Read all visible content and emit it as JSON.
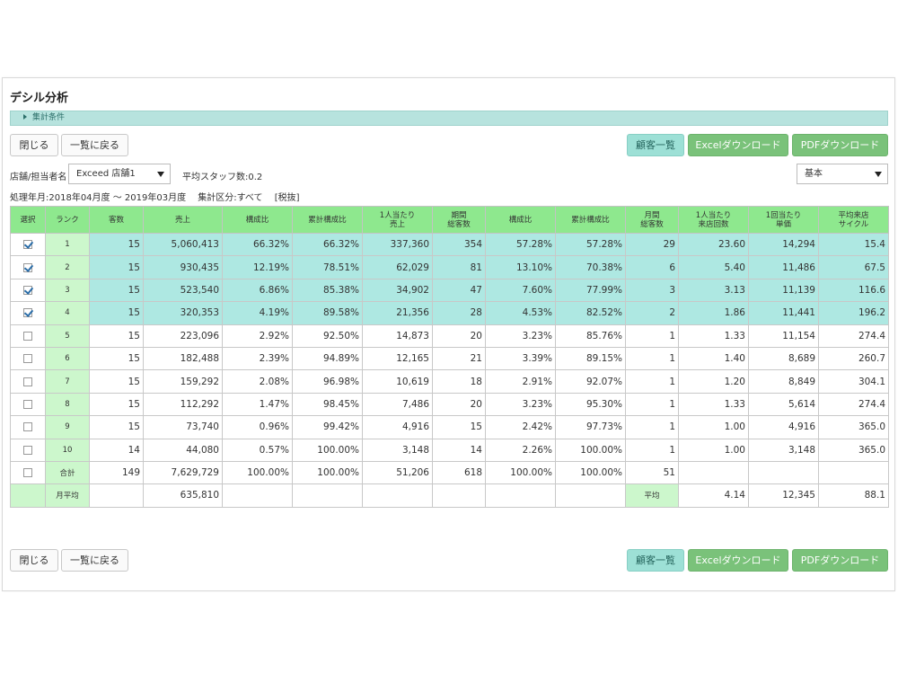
{
  "title": "デシル分析",
  "conditions_label": "集計条件",
  "buttons": {
    "close": "閉じる",
    "back": "一覧に戻る",
    "customers": "顧客一覧",
    "excel": "Excelダウンロード",
    "pdf": "PDFダウンロード"
  },
  "filters": {
    "store_label": "店舗/担当者名",
    "store_value": "Exceed 店舗1",
    "avg_staff": "平均スタッフ数:0.2",
    "mode_value": "基本",
    "period": "処理年月:2018年04月度 ～ 2019年03月度",
    "category": "集計区分:すべて",
    "tax": "[税抜]"
  },
  "table": {
    "headers": [
      [
        "選択"
      ],
      [
        "ランク"
      ],
      [
        "客数"
      ],
      [
        "売上"
      ],
      [
        "構成比"
      ],
      [
        "累計構成比"
      ],
      [
        "1人当たり",
        "売上"
      ],
      [
        "期間",
        "総客数"
      ],
      [
        "構成比"
      ],
      [
        "累計構成比"
      ],
      [
        "月間",
        "総客数"
      ],
      [
        "1人当たり",
        "来店回数"
      ],
      [
        "1回当たり",
        "単価"
      ],
      [
        "平均来店",
        "サイクル"
      ]
    ],
    "rows": [
      {
        "checked": true,
        "rank": "1",
        "cells": [
          "15",
          "5,060,413",
          "66.32%",
          "66.32%",
          "337,360",
          "354",
          "57.28%",
          "57.28%",
          "29",
          "23.60",
          "14,294",
          "15.4"
        ]
      },
      {
        "checked": true,
        "rank": "2",
        "cells": [
          "15",
          "930,435",
          "12.19%",
          "78.51%",
          "62,029",
          "81",
          "13.10%",
          "70.38%",
          "6",
          "5.40",
          "11,486",
          "67.5"
        ]
      },
      {
        "checked": true,
        "rank": "3",
        "cells": [
          "15",
          "523,540",
          "6.86%",
          "85.38%",
          "34,902",
          "47",
          "7.60%",
          "77.99%",
          "3",
          "3.13",
          "11,139",
          "116.6"
        ]
      },
      {
        "checked": true,
        "rank": "4",
        "cells": [
          "15",
          "320,353",
          "4.19%",
          "89.58%",
          "21,356",
          "28",
          "4.53%",
          "82.52%",
          "2",
          "1.86",
          "11,441",
          "196.2"
        ]
      },
      {
        "checked": false,
        "rank": "5",
        "cells": [
          "15",
          "223,096",
          "2.92%",
          "92.50%",
          "14,873",
          "20",
          "3.23%",
          "85.76%",
          "1",
          "1.33",
          "11,154",
          "274.4"
        ]
      },
      {
        "checked": false,
        "rank": "6",
        "cells": [
          "15",
          "182,488",
          "2.39%",
          "94.89%",
          "12,165",
          "21",
          "3.39%",
          "89.15%",
          "1",
          "1.40",
          "8,689",
          "260.7"
        ]
      },
      {
        "checked": false,
        "rank": "7",
        "cells": [
          "15",
          "159,292",
          "2.08%",
          "96.98%",
          "10,619",
          "18",
          "2.91%",
          "92.07%",
          "1",
          "1.20",
          "8,849",
          "304.1"
        ]
      },
      {
        "checked": false,
        "rank": "8",
        "cells": [
          "15",
          "112,292",
          "1.47%",
          "98.45%",
          "7,486",
          "20",
          "3.23%",
          "95.30%",
          "1",
          "1.33",
          "5,614",
          "274.4"
        ]
      },
      {
        "checked": false,
        "rank": "9",
        "cells": [
          "15",
          "73,740",
          "0.96%",
          "99.42%",
          "4,916",
          "15",
          "2.42%",
          "97.73%",
          "1",
          "1.00",
          "4,916",
          "365.0"
        ]
      },
      {
        "checked": false,
        "rank": "10",
        "cells": [
          "14",
          "44,080",
          "0.57%",
          "100.00%",
          "3,148",
          "14",
          "2.26%",
          "100.00%",
          "1",
          "1.00",
          "3,148",
          "365.0"
        ]
      }
    ],
    "total_row": {
      "label": "合計",
      "cells": [
        "149",
        "7,629,729",
        "100.00%",
        "100.00%",
        "51,206",
        "618",
        "100.00%",
        "100.00%",
        "51",
        "",
        "",
        ""
      ]
    },
    "avg_row": {
      "label": "月平均",
      "sales": "635,810",
      "avg_label": "平均",
      "visits": "4.14",
      "unit_price": "12,345",
      "cycle": "88.1"
    }
  }
}
